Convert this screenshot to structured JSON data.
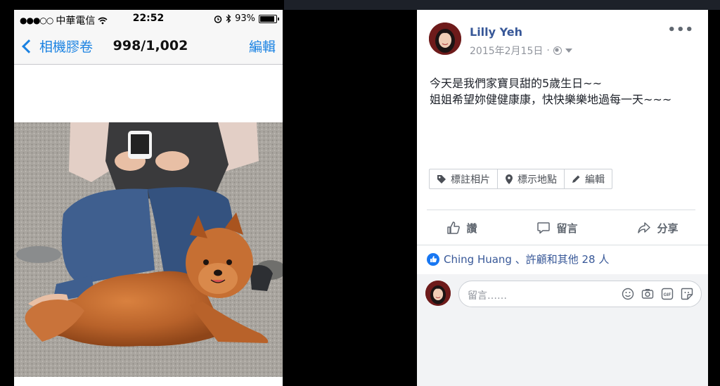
{
  "phone": {
    "status": {
      "carrier": "中華電信",
      "time": "22:52",
      "battery": "93%",
      "battery_level": 0.93
    },
    "nav": {
      "back_label": "相機膠卷",
      "title": "998/1,002",
      "edit_label": "編輯"
    }
  },
  "post": {
    "author": "Lilly Yeh",
    "date": "2015年2月15日",
    "more": "•••",
    "text_line1": "今天是我們家寶貝甜的5歲生日~~",
    "text_line2": "姐姐希望妳健健康康，快快樂樂地過每一天~~~",
    "tag_photo": "標註相片",
    "tag_location": "標示地點",
    "edit": "編輯",
    "like": "讚",
    "comment": "留言",
    "share": "分享",
    "likes_summary": "Ching Huang 、許顧和其他 28 人",
    "comment_placeholder": "留言……"
  },
  "colors": {
    "ios_blue": "#1a82e2",
    "fb_link": "#385898",
    "fb_like": "#1877f2"
  },
  "icons": [
    "wifi-icon",
    "alarm-icon",
    "bluetooth-icon",
    "battery-icon",
    "back-chevron-icon",
    "globe-icon",
    "dropdown-caret-icon",
    "more-icon",
    "tag-icon",
    "location-pin-icon",
    "pencil-icon",
    "thumbs-up-icon",
    "comment-bubble-icon",
    "share-arrow-icon",
    "like-badge-icon",
    "emoji-icon",
    "camera-icon",
    "gif-icon",
    "sticker-icon"
  ]
}
